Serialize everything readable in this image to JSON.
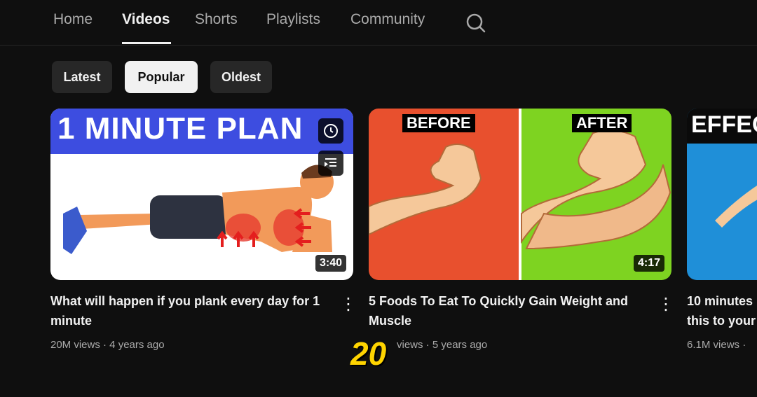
{
  "tabs": [
    {
      "label": "Home"
    },
    {
      "label": "Videos"
    },
    {
      "label": "Shorts"
    },
    {
      "label": "Playlists"
    },
    {
      "label": "Community"
    }
  ],
  "chips": [
    {
      "label": "Latest"
    },
    {
      "label": "Popular"
    },
    {
      "label": "Oldest"
    }
  ],
  "videos": [
    {
      "thumb_text": "1 MINUTE PLAN",
      "duration": "3:40",
      "title_line1": "What will happen if you plank every day for 1",
      "title_line2": "minute",
      "meta": "20M views · 4 years ago"
    },
    {
      "thumb_before": "BEFORE",
      "thumb_after": "AFTER",
      "duration": "4:17",
      "title_line1": "5 Foods To Eat To Quickly Gain Weight and",
      "title_line2": "Muscle",
      "meta": "views · 5 years ago"
    },
    {
      "thumb_text": "EFFEC",
      "title_line1": "10 minutes",
      "title_line2": "this to your",
      "meta": "6.1M views ·"
    }
  ],
  "overlay_number": "20",
  "colors": {
    "background": "#0f0f0f",
    "chip_bg": "#272727",
    "chip_selected_bg": "#f1f1f1",
    "plank_banner": "#3d4de0",
    "before_bg": "#e8502e",
    "after_bg": "#7ed321",
    "overlay_yellow": "#ffd400"
  }
}
